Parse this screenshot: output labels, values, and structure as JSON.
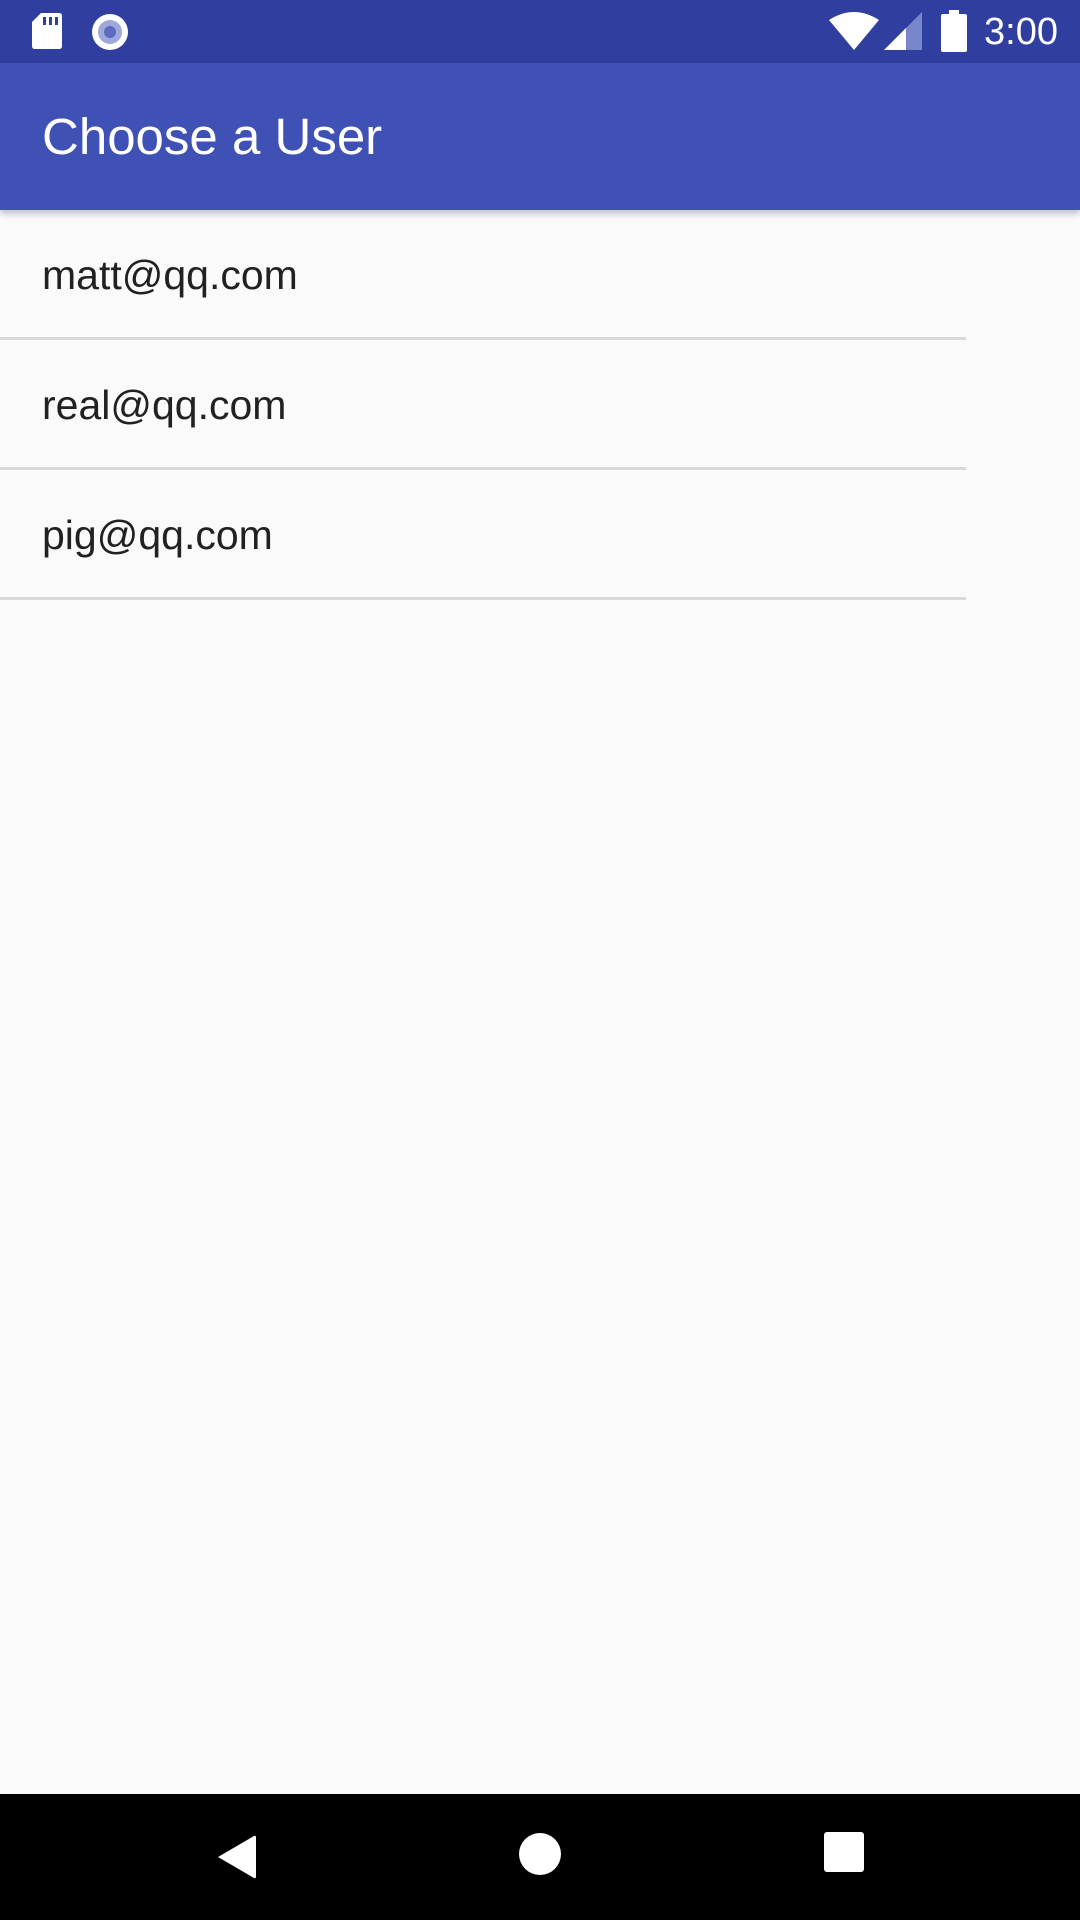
{
  "status_bar": {
    "time": "3:00",
    "icons": [
      "sd-card-icon",
      "record-icon",
      "wifi-icon",
      "signal-icon",
      "battery-icon"
    ],
    "background": "#303f9f"
  },
  "app_bar": {
    "title": "Choose a User",
    "background": "#3f51b5"
  },
  "users": [
    {
      "email": "matt@qq.com"
    },
    {
      "email": "real@qq.com"
    },
    {
      "email": "pig@qq.com"
    }
  ],
  "nav_bar": {
    "icons": [
      "back-icon",
      "home-icon",
      "recents-icon"
    ]
  }
}
